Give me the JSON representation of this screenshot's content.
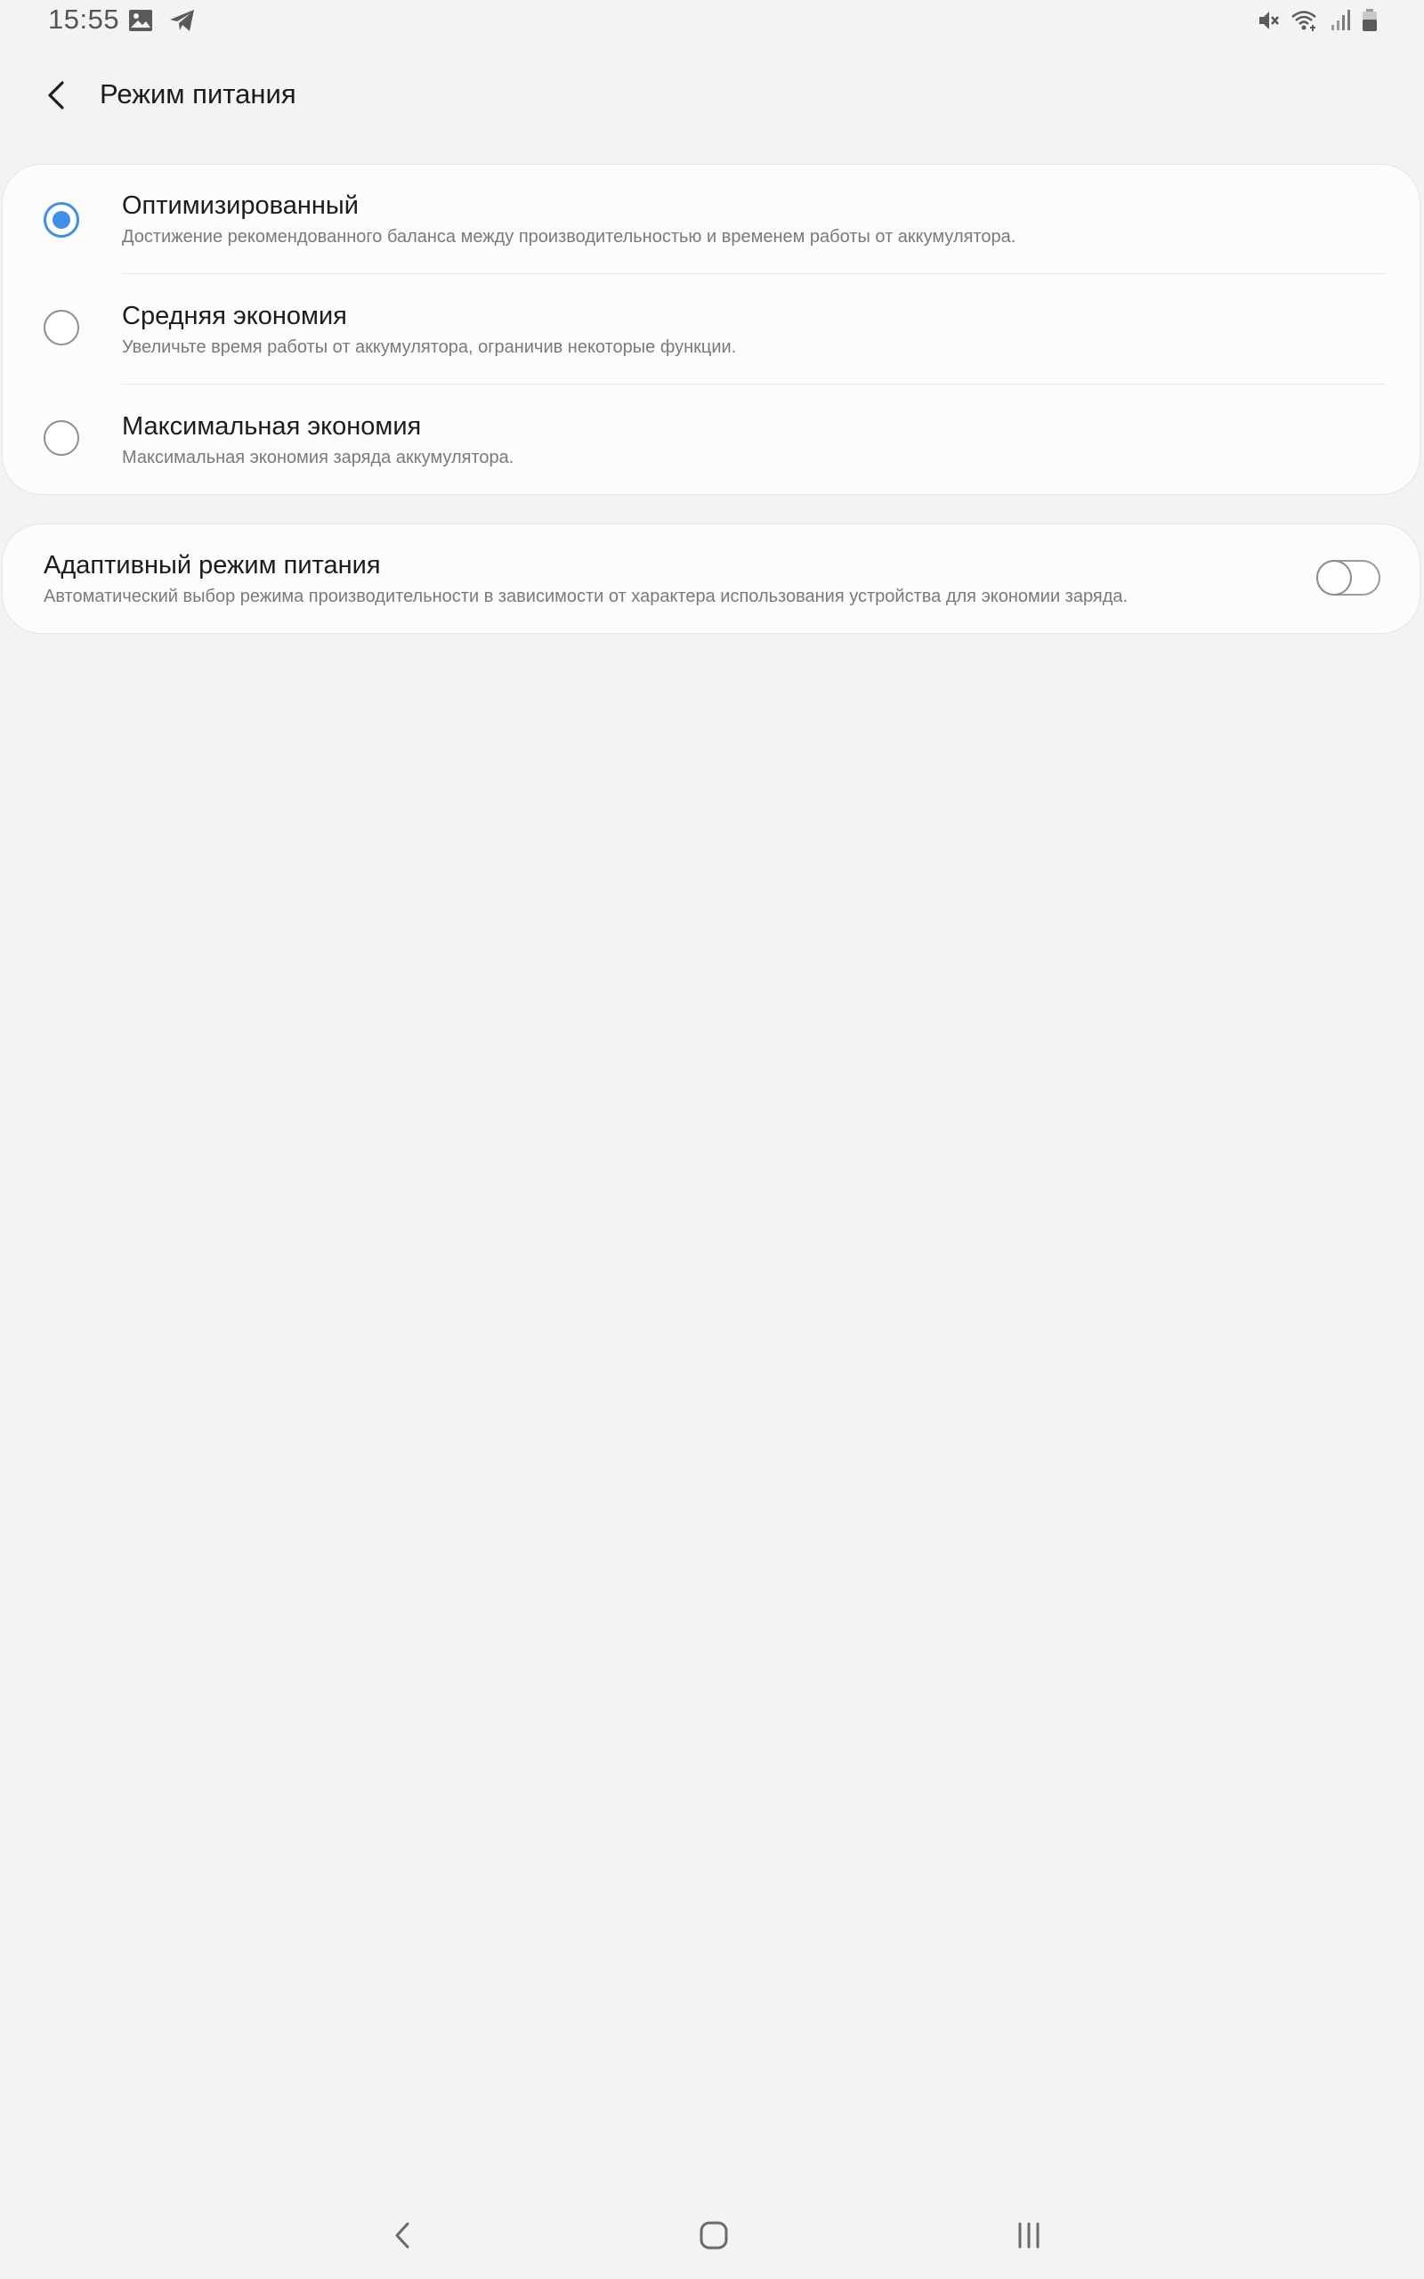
{
  "status_bar": {
    "time": "15:55",
    "left_icons": [
      "gallery-icon",
      "telegram-icon"
    ],
    "right_icons": [
      "mute-icon",
      "wifi-icon",
      "signal-icon",
      "battery-icon"
    ]
  },
  "app_bar": {
    "title": "Режим питания",
    "back_icon": "chevron-left-icon"
  },
  "power_modes": {
    "selected_index": 0,
    "items": [
      {
        "title": "Оптимизированный",
        "description": "Достижение рекомендованного баланса между производительностью и временем работы от аккумулятора.",
        "checked": true
      },
      {
        "title": "Средняя экономия",
        "description": "Увеличьте время работы от аккумулятора, ограничив некоторые функции.",
        "checked": false
      },
      {
        "title": "Максимальная экономия",
        "description": "Максимальная экономия заряда аккумулятора.",
        "checked": false
      }
    ]
  },
  "adaptive": {
    "title": "Адаптивный режим питания",
    "description": "Автоматический выбор режима производительности в зависимости от характера использования устройства для экономии заряда.",
    "enabled": false
  },
  "nav_bar": {
    "buttons": [
      "back-icon",
      "home-icon",
      "recents-icon"
    ]
  },
  "colors": {
    "background": "#f3f3f3",
    "card": "#fcfcfc",
    "accent": "#3e91e6",
    "secondary_text": "#7a7a7a"
  }
}
